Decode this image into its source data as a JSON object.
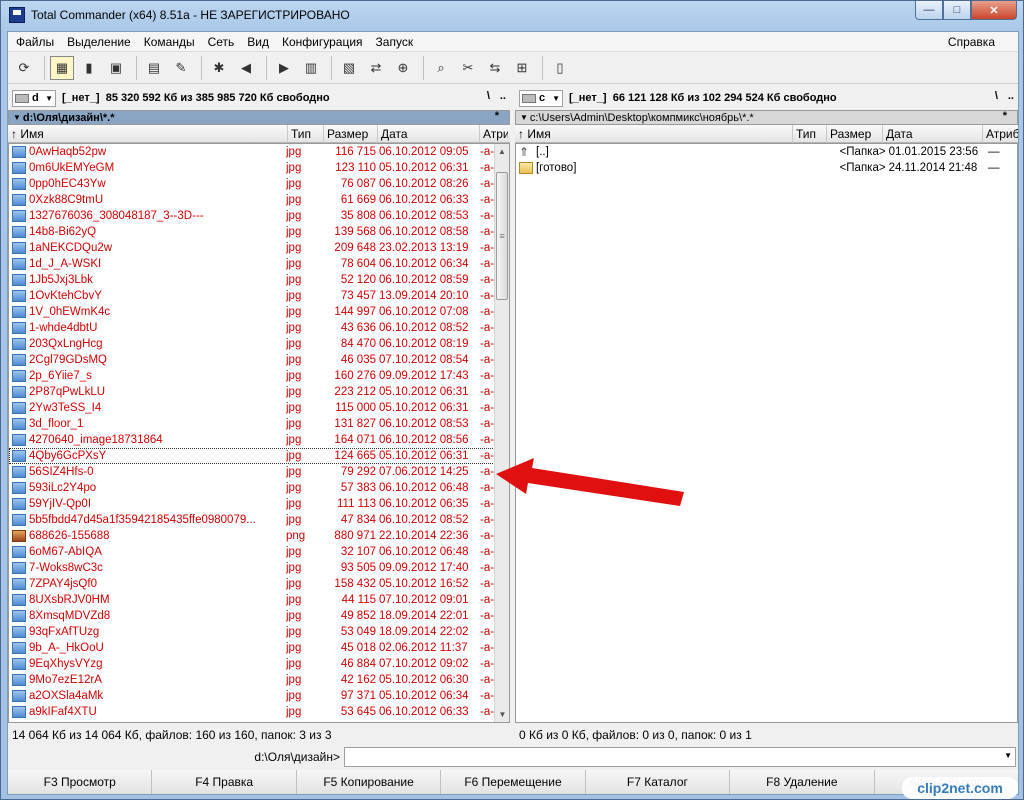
{
  "window": {
    "title": "Total Commander (x64) 8.51a - НЕ ЗАРЕГИСТРИРОВАНО",
    "min": "—",
    "max": "□",
    "close": "✕"
  },
  "menu": {
    "items": [
      "Файлы",
      "Выделение",
      "Команды",
      "Сеть",
      "Вид",
      "Конфигурация",
      "Запуск"
    ],
    "help": "Справка"
  },
  "toolbar": {
    "icons": [
      "refresh-icon",
      "brief-view-icon",
      "detailed-view-icon",
      "thumbnail-view-icon",
      "tree-view-icon",
      "invert-selection-icon",
      "pack-icon",
      "back-icon",
      "forward-icon",
      "zip-pack-icon",
      "zip-unpack-icon",
      "ftp-icon",
      "url-icon",
      "search-icon",
      "multi-rename-icon",
      "sync-dirs-icon",
      "compare-icon",
      "notepad-icon"
    ],
    "glyphs": [
      "⟳",
      "▦",
      "▮",
      "▣",
      "▤",
      "✎",
      "✱",
      "◀",
      "▶",
      "▥",
      "▧",
      "⇄",
      "⊕",
      "⌕",
      "✂",
      "⇆",
      "⊞",
      "▯"
    ]
  },
  "left": {
    "drive": "d",
    "volume": "[_нет_]",
    "free": "85 320 592 Кб из 385 985 720 Кб свободно",
    "root_btn": "\\",
    "up_btn": "..",
    "path": "d:\\Оля\\дизайн\\*.*",
    "star": "*",
    "hist": "▼",
    "headers": {
      "name": "Имя",
      "ext": "Тип",
      "size": "Размер",
      "date": "Дата",
      "attr": "Атрибуты"
    },
    "files": [
      {
        "name": "0AwHaqb52pw",
        "ext": "jpg",
        "size": "116 715",
        "date": "06.10.2012 09:05",
        "attr": "-a-"
      },
      {
        "name": "0m6UkEMYeGM",
        "ext": "jpg",
        "size": "123 110",
        "date": "05.10.2012 06:31",
        "attr": "-a-"
      },
      {
        "name": "0pp0hEC43Yw",
        "ext": "jpg",
        "size": "76 087",
        "date": "06.10.2012 08:26",
        "attr": "-a-"
      },
      {
        "name": "0Xzk88C9tmU",
        "ext": "jpg",
        "size": "61 669",
        "date": "06.10.2012 06:33",
        "attr": "-a-"
      },
      {
        "name": "1327676036_308048187_3--3D---",
        "ext": "jpg",
        "size": "35 808",
        "date": "06.10.2012 08:53",
        "attr": "-a-"
      },
      {
        "name": "14b8-Bi62yQ",
        "ext": "jpg",
        "size": "139 568",
        "date": "06.10.2012 08:58",
        "attr": "-a-"
      },
      {
        "name": "1aNEKCDQu2w",
        "ext": "jpg",
        "size": "209 648",
        "date": "23.02.2013 13:19",
        "attr": "-a-"
      },
      {
        "name": "1d_J_A-WSKI",
        "ext": "jpg",
        "size": "78 604",
        "date": "06.10.2012 06:34",
        "attr": "-a-"
      },
      {
        "name": "1Jb5Jxj3Lbk",
        "ext": "jpg",
        "size": "52 120",
        "date": "06.10.2012 08:59",
        "attr": "-a-"
      },
      {
        "name": "1OvKtehCbvY",
        "ext": "jpg",
        "size": "73 457",
        "date": "13.09.2014 20:10",
        "attr": "-a-"
      },
      {
        "name": "1V_0hEWmK4c",
        "ext": "jpg",
        "size": "144 997",
        "date": "06.10.2012 07:08",
        "attr": "-a-"
      },
      {
        "name": "1-whde4dbtU",
        "ext": "jpg",
        "size": "43 636",
        "date": "06.10.2012 08:52",
        "attr": "-a-"
      },
      {
        "name": "203QxLngHcg",
        "ext": "jpg",
        "size": "84 470",
        "date": "06.10.2012 08:19",
        "attr": "-a-"
      },
      {
        "name": "2Cgl79GDsMQ",
        "ext": "jpg",
        "size": "46 035",
        "date": "07.10.2012 08:54",
        "attr": "-a-"
      },
      {
        "name": "2p_6Yiie7_s",
        "ext": "jpg",
        "size": "160 276",
        "date": "09.09.2012 17:43",
        "attr": "-a-"
      },
      {
        "name": "2P87qPwLkLU",
        "ext": "jpg",
        "size": "223 212",
        "date": "05.10.2012 06:31",
        "attr": "-a-"
      },
      {
        "name": "2Yw3TeSS_I4",
        "ext": "jpg",
        "size": "115 000",
        "date": "05.10.2012 06:31",
        "attr": "-a-"
      },
      {
        "name": "3d_floor_1",
        "ext": "jpg",
        "size": "131 827",
        "date": "06.10.2012 08:53",
        "attr": "-a-"
      },
      {
        "name": "4270640_image18731864",
        "ext": "jpg",
        "size": "164 071",
        "date": "06.10.2012 08:56",
        "attr": "-a-"
      },
      {
        "name": "4Qby6GcPXsY",
        "ext": "jpg",
        "size": "124 665",
        "date": "05.10.2012 06:31",
        "attr": "-a-"
      },
      {
        "name": "56SIZ4Hfs-0",
        "ext": "jpg",
        "size": "79 292",
        "date": "07.06.2012 14:25",
        "attr": "-a-"
      },
      {
        "name": "593iLc2Y4po",
        "ext": "jpg",
        "size": "57 383",
        "date": "06.10.2012 06:48",
        "attr": "-a-"
      },
      {
        "name": "59YjIV-Qp0I",
        "ext": "jpg",
        "size": "111 113",
        "date": "06.10.2012 06:35",
        "attr": "-a-"
      },
      {
        "name": "5b5fbdd47d45a1f35942185435ffe0980079...",
        "ext": "jpg",
        "size": "47 834",
        "date": "06.10.2012 08:52",
        "attr": "-a-"
      },
      {
        "name": "688626-155688",
        "ext": "png",
        "size": "880 971",
        "date": "22.10.2014 22:36",
        "attr": "-a-"
      },
      {
        "name": "6oM67-AbIQA",
        "ext": "jpg",
        "size": "32 107",
        "date": "06.10.2012 06:48",
        "attr": "-a-"
      },
      {
        "name": "7-Woks8wC3c",
        "ext": "jpg",
        "size": "93 505",
        "date": "09.09.2012 17:40",
        "attr": "-a-"
      },
      {
        "name": "7ZPAY4jsQf0",
        "ext": "jpg",
        "size": "158 432",
        "date": "05.10.2012 16:52",
        "attr": "-a-"
      },
      {
        "name": "8UXsbRJV0HM",
        "ext": "jpg",
        "size": "44 115",
        "date": "07.10.2012 09:01",
        "attr": "-a-"
      },
      {
        "name": "8XmsqMDVZd8",
        "ext": "jpg",
        "size": "49 852",
        "date": "18.09.2014 22:01",
        "attr": "-a-"
      },
      {
        "name": "93qFxAfTUzg",
        "ext": "jpg",
        "size": "53 049",
        "date": "18.09.2014 22:02",
        "attr": "-a-"
      },
      {
        "name": "9b_A-_HkOoU",
        "ext": "jpg",
        "size": "45 018",
        "date": "02.06.2012 11:37",
        "attr": "-a-"
      },
      {
        "name": "9EqXhysVYzg",
        "ext": "jpg",
        "size": "46 884",
        "date": "07.10.2012 09:02",
        "attr": "-a-"
      },
      {
        "name": "9Mo7ezE12rA",
        "ext": "jpg",
        "size": "42 162",
        "date": "05.10.2012 06:30",
        "attr": "-a-"
      },
      {
        "name": "a2OXSla4aMk",
        "ext": "jpg",
        "size": "97 371",
        "date": "05.10.2012 06:34",
        "attr": "-a-"
      },
      {
        "name": "a9kIFaf4XTU",
        "ext": "jpg",
        "size": "53 645",
        "date": "06.10.2012 06:33",
        "attr": "-a-"
      }
    ],
    "status": "14 064 Кб из 14 064 Кб, файлов: 160 из 160, папок: 3 из 3"
  },
  "right": {
    "drive": "c",
    "volume": "[_нет_]",
    "free": "66 121 128 Кб из 102 294 524 Кб свободно",
    "root_btn": "\\",
    "up_btn": "..",
    "path": "c:\\Users\\Admin\\Desktop\\компмикс\\ноябрь\\*.*",
    "star": "*",
    "hist": "▼",
    "headers": {
      "name": "Имя",
      "ext": "Тип",
      "size": "Размер",
      "date": "Дата",
      "attr": "Атрибуты"
    },
    "files": [
      {
        "name": "[..]",
        "ext": "",
        "size": "<Папка>",
        "date": "01.01.2015 23:56",
        "attr": "—",
        "kind": "up"
      },
      {
        "name": "[готово]",
        "ext": "",
        "size": "<Папка>",
        "date": "24.11.2014 21:48",
        "attr": "—",
        "kind": "folder"
      }
    ],
    "status": "0 Кб из 0 Кб, файлов: 0 из 0, папок: 0 из 1"
  },
  "cmd": {
    "path": "d:\\Оля\\дизайн>",
    "value": ""
  },
  "fkeys": [
    "F3 Просмотр",
    "F4 Правка",
    "F5 Копирование",
    "F6 Перемещение",
    "F7 Каталог",
    "F8 Удаление",
    "Alt+F4 Выход"
  ],
  "watermark": "clip2net.com",
  "colors": {
    "file_text": "#d40000",
    "arrow": "#e01010",
    "active_path_bg": "#8aa5c4"
  }
}
